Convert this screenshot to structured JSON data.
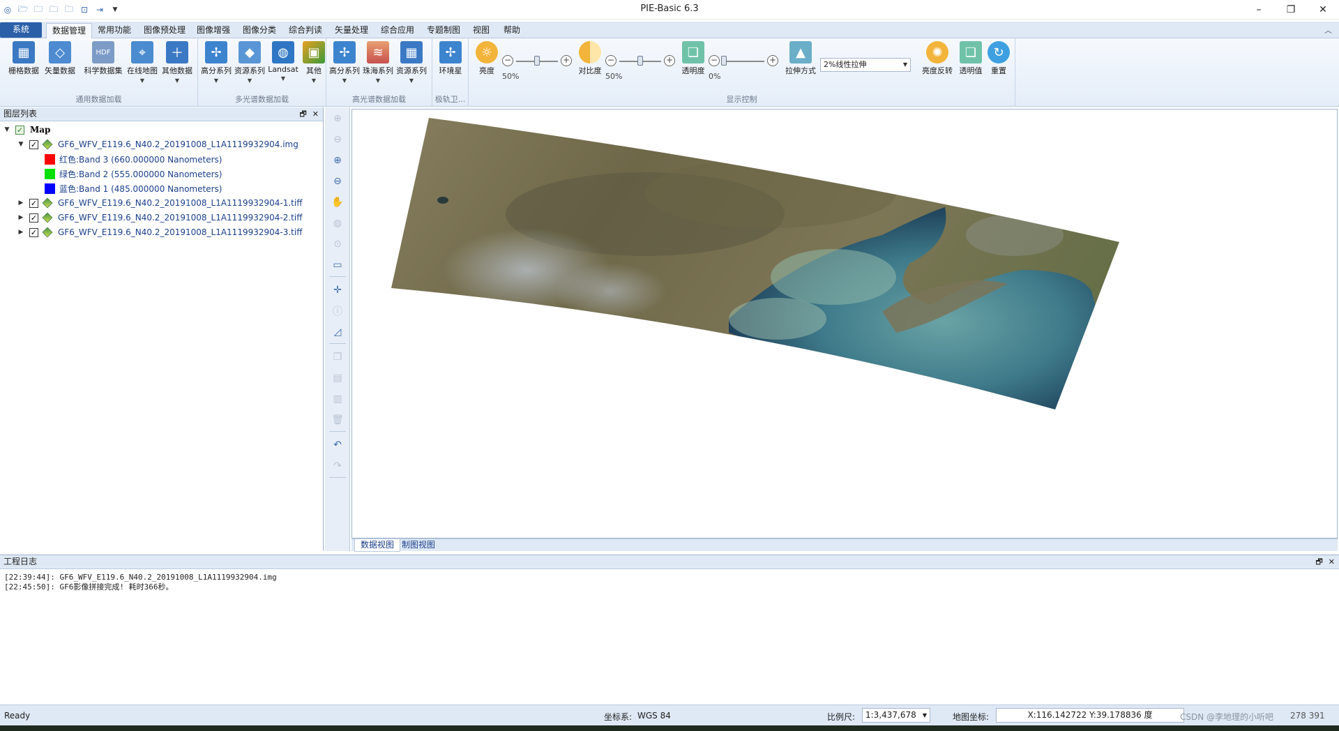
{
  "window": {
    "title": "PIE-Basic 6.3",
    "minimize": "–",
    "restore": "❐",
    "close": "✕"
  },
  "ribbon": {
    "system_tab": "系统",
    "tabs": [
      "数据管理",
      "常用功能",
      "图像预处理",
      "图像增强",
      "图像分类",
      "综合判读",
      "矢量处理",
      "综合应用",
      "专题制图",
      "视图",
      "帮助"
    ],
    "active_tab": "数据管理",
    "groups": {
      "general_load": {
        "label": "通用数据加载",
        "buttons": [
          "栅格数据",
          "矢量数据",
          "科学数据集",
          "在线地图",
          "其他数据"
        ]
      },
      "multispectral": {
        "label": "多光谱数据加载",
        "buttons": [
          "高分系列",
          "资源系列",
          "Landsat",
          "其他"
        ]
      },
      "hyperspectral": {
        "label": "高光谱数据加载",
        "buttons": [
          "高分系列",
          "珠海系列",
          "资源系列"
        ]
      },
      "polar": {
        "label": "极轨卫...",
        "buttons": [
          "环境星"
        ]
      },
      "display": {
        "label": "显示控制",
        "brightness": {
          "label": "亮度",
          "value": "50%",
          "level": 0.5
        },
        "contrast": {
          "label": "对比度",
          "value": "50%",
          "level": 0.5
        },
        "transparency": {
          "label": "透明度",
          "value": "0%",
          "level": 0.0
        },
        "stretch_label": "拉伸方式",
        "stretch_value": "2%线性拉伸",
        "invert_label": "亮度反转",
        "transparent_value_label": "透明值",
        "redraw_label": "重置"
      }
    }
  },
  "layer_panel": {
    "title": "图层列表",
    "root": "Map",
    "layers": [
      {
        "name": "GF6_WFV_E119.6_N40.2_20191008_L1A1119932904.img",
        "expanded": true,
        "bands": [
          {
            "label": "红色:Band 3 (660.000000 Nanometers)",
            "color": "#ff0000"
          },
          {
            "label": "绿色:Band 2 (555.000000 Nanometers)",
            "color": "#00e000"
          },
          {
            "label": "蓝色:Band 1 (485.000000 Nanometers)",
            "color": "#0000ff"
          }
        ]
      },
      {
        "name": "GF6_WFV_E119.6_N40.2_20191008_L1A1119932904-1.tiff",
        "expanded": false
      },
      {
        "name": "GF6_WFV_E119.6_N40.2_20191008_L1A1119932904-2.tiff",
        "expanded": false
      },
      {
        "name": "GF6_WFV_E119.6_N40.2_20191008_L1A1119932904-3.tiff",
        "expanded": false
      }
    ]
  },
  "view_tabs": [
    "数据视图",
    "制图视图"
  ],
  "log_panel": {
    "title": "工程日志",
    "lines": [
      "[22:39:44]: GF6_WFV_E119.6_N40.2_20191008_L1A1119932904.img",
      "[22:45:50]: GF6影像拼接完成! 耗时366秒。"
    ]
  },
  "statusbar": {
    "ready": "Ready",
    "crs_label": "坐标系:",
    "crs_value": "WGS 84",
    "scale_label": "比例尺:",
    "scale_value": "1:3,437,678",
    "coord_label": "地图坐标:",
    "coord_value": "X:116.142722 Y:39.178836 度",
    "right_partial": "CSDN @李地理的小听吧",
    "right_extra": "278 391"
  },
  "colors": {
    "ribbon_bg": "#e4edf8",
    "system_tab": "#2b5fa8",
    "panel_header": "#dfe9f5",
    "layer_text": "#1a3f8a"
  }
}
